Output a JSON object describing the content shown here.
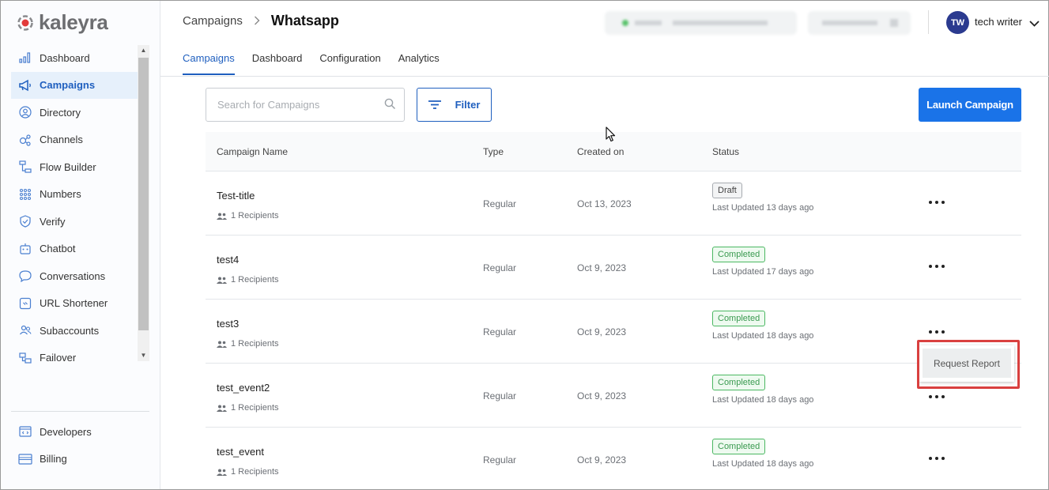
{
  "brand": {
    "name": "kaleyra",
    "accent": "#1a73e8",
    "logo_color": "#e23b3b"
  },
  "sidebar": {
    "items": [
      {
        "label": "Dashboard",
        "icon": "bar-chart-icon"
      },
      {
        "label": "Campaigns",
        "icon": "megaphone-icon",
        "active": true
      },
      {
        "label": "Directory",
        "icon": "person-circle-icon"
      },
      {
        "label": "Channels",
        "icon": "channels-icon"
      },
      {
        "label": "Flow Builder",
        "icon": "flow-icon"
      },
      {
        "label": "Numbers",
        "icon": "dialpad-icon"
      },
      {
        "label": "Verify",
        "icon": "shield-check-icon"
      },
      {
        "label": "Chatbot",
        "icon": "robot-icon"
      },
      {
        "label": "Conversations",
        "icon": "chat-bubble-icon"
      },
      {
        "label": "URL Shortener",
        "icon": "link-icon"
      },
      {
        "label": "Subaccounts",
        "icon": "users-icon"
      },
      {
        "label": "Failover",
        "icon": "failover-icon"
      }
    ],
    "bottom_items": [
      {
        "label": "Developers",
        "icon": "code-window-icon"
      },
      {
        "label": "Billing",
        "icon": "card-icon"
      }
    ]
  },
  "header": {
    "breadcrumb_root": "Campaigns",
    "breadcrumb_current": "Whatsapp",
    "user_initials": "TW",
    "user_name": "tech writer"
  },
  "tabs": [
    {
      "label": "Campaigns",
      "active": true
    },
    {
      "label": "Dashboard"
    },
    {
      "label": "Configuration"
    },
    {
      "label": "Analytics"
    }
  ],
  "toolbar": {
    "search_placeholder": "Search for Campaigns",
    "filter_label": "Filter",
    "launch_label": "Launch Campaign"
  },
  "table": {
    "columns": {
      "name": "Campaign Name",
      "type": "Type",
      "created": "Created on",
      "status": "Status"
    },
    "rows": [
      {
        "name": "Test-title",
        "recipients": "1 Recipients",
        "type": "Regular",
        "created": "Oct 13, 2023",
        "status": "Draft",
        "updated": "Last Updated 13 days ago"
      },
      {
        "name": "test4",
        "recipients": "1 Recipients",
        "type": "Regular",
        "created": "Oct 9, 2023",
        "status": "Completed",
        "updated": "Last Updated 17 days ago"
      },
      {
        "name": "test3",
        "recipients": "1 Recipients",
        "type": "Regular",
        "created": "Oct 9, 2023",
        "status": "Completed",
        "updated": "Last Updated 18 days ago"
      },
      {
        "name": "test_event2",
        "recipients": "1 Recipients",
        "type": "Regular",
        "created": "Oct 9, 2023",
        "status": "Completed",
        "updated": "Last Updated 18 days ago"
      },
      {
        "name": "test_event",
        "recipients": "1 Recipients",
        "type": "Regular",
        "created": "Oct 9, 2023",
        "status": "Completed",
        "updated": "Last Updated 18 days ago"
      }
    ]
  },
  "row_menu": {
    "item_label": "Request Report"
  },
  "colors": {
    "completed": "#3a9a50",
    "draft_border": "#a7abb0",
    "highlight": "#d9403f"
  }
}
